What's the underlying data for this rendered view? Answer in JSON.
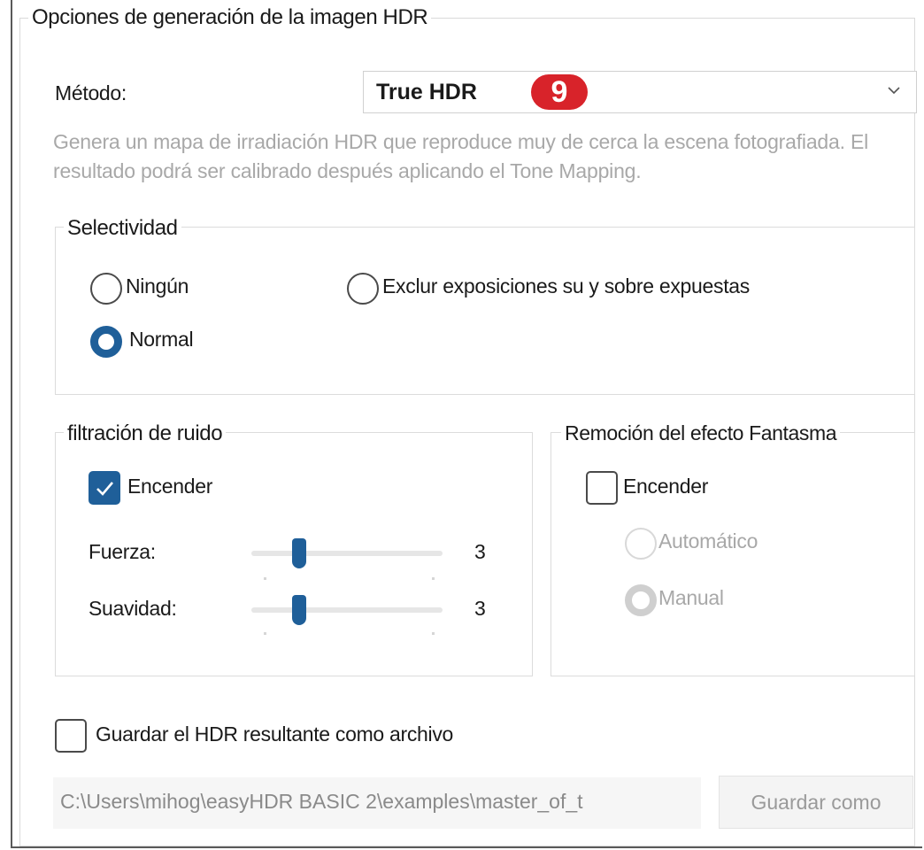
{
  "panel": {
    "title": "Opciones de generación de la imagen HDR"
  },
  "method": {
    "label": "Método:",
    "value": "True HDR",
    "badge": "9",
    "description": "Genera un mapa de irradiación HDR que reproduce muy de cerca la escena fotografiada. El resultado podrá ser calibrado después aplicando el Tone Mapping."
  },
  "selectivity": {
    "title": "Selectividad",
    "options": [
      {
        "label": "Ningún",
        "selected": false
      },
      {
        "label": "Exclur exposiciones su y sobre expuestas",
        "selected": false
      },
      {
        "label": "Normal",
        "selected": true
      }
    ]
  },
  "noise": {
    "title": "filtración de ruido",
    "enable_label": "Encender",
    "enabled": true,
    "strength_label": "Fuerza:",
    "strength_value": "3",
    "smoothness_label": "Suavidad:",
    "smoothness_value": "3"
  },
  "ghost": {
    "title": "Remoción del efecto Fantasma",
    "enable_label": "Encender",
    "enabled": false,
    "auto_label": "Automático",
    "manual_label": "Manual"
  },
  "save": {
    "checkbox_label": "Guardar el HDR resultante como archivo",
    "path": "C:\\Users\\mihog\\easyHDR BASIC 2\\examples\\master_of_t",
    "button_label": "Guardar como"
  },
  "colors": {
    "accent": "#1f5f99",
    "badge": "#d8232a"
  }
}
